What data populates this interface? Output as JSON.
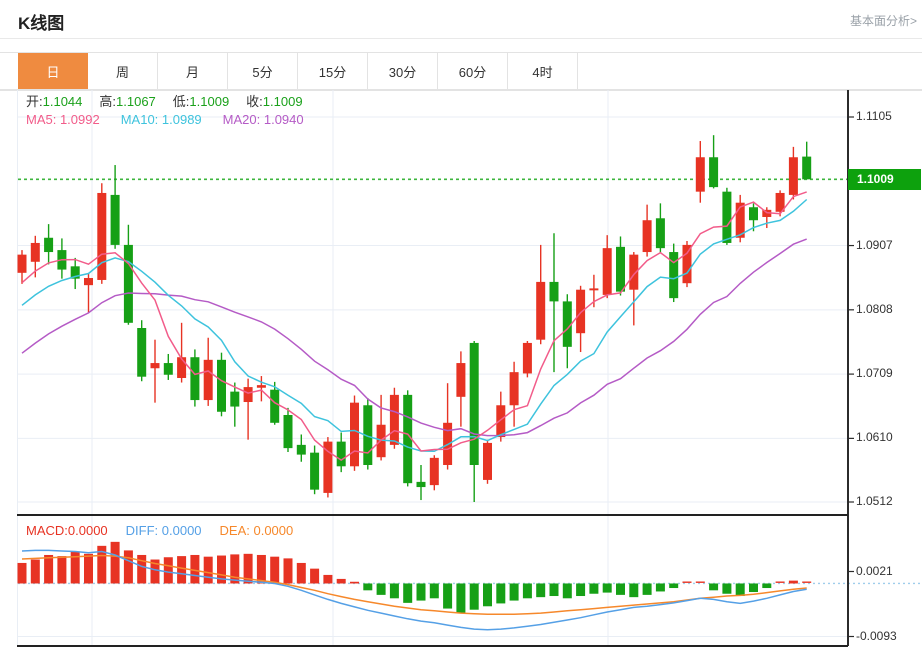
{
  "header": {
    "title": "K线图",
    "link": "基本面分析>"
  },
  "tabs": {
    "items": [
      "日",
      "周",
      "月",
      "5分",
      "15分",
      "30分",
      "60分",
      "4时"
    ],
    "active_index": 0
  },
  "overlay": {
    "ohlc": [
      {
        "label": "开:",
        "value": "1.1044"
      },
      {
        "label": "高:",
        "value": "1.1067"
      },
      {
        "label": "低:",
        "value": "1.1009"
      },
      {
        "label": "收:",
        "value": "1.1009"
      }
    ],
    "ma_legend": [
      {
        "text": "MA5: 1.0992",
        "color": "#f25c8a"
      },
      {
        "text": "MA10: 1.0989",
        "color": "#3ec3dd"
      },
      {
        "text": "MA20: 1.0940",
        "color": "#b55bc6"
      }
    ],
    "macd_legend": [
      {
        "text": "MACD:0.0000",
        "color": "#e73323"
      },
      {
        "text": "DIFF: 0.0000",
        "color": "#55a0e6"
      },
      {
        "text": "DEA: 0.0000",
        "color": "#f6882b"
      }
    ]
  },
  "axis": {
    "price_ticks": [
      {
        "label": "1.1105",
        "price": 1.1105
      },
      {
        "label": "1.0907",
        "price": 1.0907
      },
      {
        "label": "1.0808",
        "price": 1.0808
      },
      {
        "label": "1.0709",
        "price": 1.0709
      },
      {
        "label": "1.0610",
        "price": 1.061
      },
      {
        "label": "1.0512",
        "price": 1.0512
      }
    ],
    "macd_ticks": [
      {
        "label": "0.0021",
        "value": 0.0021
      },
      {
        "label": "-0.0093",
        "value": -0.0093
      }
    ],
    "current_price_label": "1.1009",
    "current_price": 1.1009
  },
  "colors": {
    "up": "#e73323",
    "down": "#16a016",
    "tab_active": "#ef8b40",
    "ohlc_value": "#1ba11b",
    "ma5": "#f25c8a",
    "ma10": "#3ec3dd",
    "ma20": "#b55bc6",
    "diff": "#55a0e6",
    "dea": "#f6882b",
    "price_line": "#3db53d",
    "price_flag_bg": "#0da10d",
    "grid": "#e9eef5",
    "zero_dash": "#9fcdec",
    "axis_line": "#2b2b2b"
  },
  "chart_data": {
    "type": "candlestick",
    "title": "K线图 (daily)",
    "price_axis_range": [
      1.0512,
      1.1105
    ],
    "macd_axis_range": [
      -0.0093,
      0.0021
    ],
    "legend_values": {
      "MA5": 1.0992,
      "MA10": 1.0989,
      "MA20": 1.094,
      "MACD": 0.0,
      "DIFF": 0.0,
      "DEA": 0.0
    },
    "ohlc_last": {
      "open": 1.1044,
      "high": 1.1067,
      "low": 1.1009,
      "close": 1.1009
    },
    "candles": [
      [
        1.0865,
        1.09,
        1.0848,
        1.0893
      ],
      [
        1.0882,
        1.0922,
        1.0858,
        1.0911
      ],
      [
        1.0919,
        1.094,
        1.0878,
        1.0897
      ],
      [
        1.09,
        1.0918,
        1.0856,
        1.087
      ],
      [
        1.0875,
        1.0888,
        1.084,
        1.0856
      ],
      [
        1.0846,
        1.0864,
        1.0803,
        1.0857
      ],
      [
        1.0854,
        1.1003,
        1.0848,
        1.0988
      ],
      [
        1.0985,
        1.1031,
        1.0902,
        1.0908
      ],
      [
        1.0908,
        1.0939,
        1.0785,
        1.0788
      ],
      [
        1.078,
        1.0792,
        1.0698,
        1.0705
      ],
      [
        1.0718,
        1.0762,
        1.0665,
        1.0726
      ],
      [
        1.0726,
        1.074,
        1.07,
        1.0708
      ],
      [
        1.0703,
        1.0788,
        1.0696,
        1.0735
      ],
      [
        1.0735,
        1.0747,
        1.0659,
        1.0669
      ],
      [
        1.0669,
        1.0765,
        1.066,
        1.0731
      ],
      [
        1.0731,
        1.0742,
        1.0644,
        1.0651
      ],
      [
        1.0682,
        1.0696,
        1.0628,
        1.0659
      ],
      [
        1.0666,
        1.0702,
        1.0608,
        1.0689
      ],
      [
        1.0688,
        1.0706,
        1.0667,
        1.0692
      ],
      [
        1.0685,
        1.0697,
        1.0631,
        1.0634
      ],
      [
        1.0646,
        1.0657,
        1.0589,
        1.0595
      ],
      [
        1.06,
        1.0616,
        1.0574,
        1.0585
      ],
      [
        1.0588,
        1.0599,
        1.0524,
        1.0531
      ],
      [
        1.0526,
        1.0612,
        1.0519,
        1.0605
      ],
      [
        1.0605,
        1.0619,
        1.0558,
        1.0567
      ],
      [
        1.0567,
        1.0676,
        1.056,
        1.0665
      ],
      [
        1.0661,
        1.0672,
        1.0562,
        1.0569
      ],
      [
        1.0581,
        1.0677,
        1.0576,
        1.0631
      ],
      [
        1.06,
        1.0688,
        1.0594,
        1.0677
      ],
      [
        1.0677,
        1.0684,
        1.0536,
        1.0541
      ],
      [
        1.0543,
        1.0569,
        1.0515,
        1.0535
      ],
      [
        1.0538,
        1.0584,
        1.053,
        1.058
      ],
      [
        1.0569,
        1.0695,
        1.0562,
        1.0634
      ],
      [
        1.0674,
        1.0744,
        1.0628,
        1.0726
      ],
      [
        1.0757,
        1.076,
        1.0512,
        1.0569
      ],
      [
        1.0546,
        1.0608,
        1.054,
        1.0603
      ],
      [
        1.0612,
        1.0682,
        1.0605,
        1.0661
      ],
      [
        1.0661,
        1.0728,
        1.0628,
        1.0712
      ],
      [
        1.071,
        1.076,
        1.0704,
        1.0757
      ],
      [
        1.0762,
        1.0908,
        1.0755,
        1.0851
      ],
      [
        1.0851,
        1.0926,
        1.0712,
        1.0821
      ],
      [
        1.0821,
        1.0832,
        1.0718,
        1.0751
      ],
      [
        1.0772,
        1.0845,
        1.0743,
        1.0839
      ],
      [
        1.0838,
        1.0862,
        1.0812,
        1.0841
      ],
      [
        1.0831,
        1.0923,
        1.0826,
        1.0903
      ],
      [
        1.0905,
        1.0921,
        1.083,
        1.0836
      ],
      [
        1.0839,
        1.0897,
        1.0784,
        1.0893
      ],
      [
        1.0897,
        1.097,
        1.089,
        1.0946
      ],
      [
        1.0949,
        1.0972,
        1.0896,
        1.0903
      ],
      [
        1.0897,
        1.091,
        1.082,
        1.0826
      ],
      [
        1.0849,
        1.0914,
        1.0843,
        1.0908
      ],
      [
        1.099,
        1.1068,
        1.0973,
        1.1043
      ],
      [
        1.1043,
        1.1077,
        1.0995,
        1.0997
      ],
      [
        1.099,
        1.0996,
        1.0908,
        1.0911
      ],
      [
        1.0919,
        1.0985,
        1.0912,
        1.0973
      ],
      [
        1.0966,
        1.0972,
        1.0929,
        1.0946
      ],
      [
        1.0951,
        1.0966,
        1.0934,
        1.0962
      ],
      [
        1.0959,
        1.0992,
        1.0952,
        1.0988
      ],
      [
        1.0985,
        1.1059,
        1.0978,
        1.1043
      ],
      [
        1.1044,
        1.1067,
        1.1009,
        1.1009
      ]
    ],
    "ma_periods": [
      5,
      10,
      20
    ],
    "ma_seed_closes": [
      1.06,
      1.0615,
      1.063,
      1.0645,
      1.066,
      1.0675,
      1.069,
      1.0705,
      1.072,
      1.0735,
      1.075,
      1.0765,
      1.078,
      1.0795,
      1.081,
      1.0822,
      1.0834,
      1.0845,
      1.0855
    ],
    "macd_histogram": [
      0.0036,
      0.0042,
      0.005,
      0.0048,
      0.0056,
      0.0052,
      0.0066,
      0.0073,
      0.0058,
      0.005,
      0.0042,
      0.0046,
      0.0048,
      0.005,
      0.0047,
      0.0049,
      0.0051,
      0.0052,
      0.005,
      0.0047,
      0.0044,
      0.0036,
      0.0026,
      0.0015,
      0.0008,
      0.0003,
      -0.0012,
      -0.002,
      -0.0026,
      -0.0034,
      -0.003,
      -0.0026,
      -0.0044,
      -0.0052,
      -0.0046,
      -0.004,
      -0.0035,
      -0.003,
      -0.0026,
      -0.0024,
      -0.0022,
      -0.0026,
      -0.0022,
      -0.0018,
      -0.0016,
      -0.002,
      -0.0024,
      -0.002,
      -0.0014,
      -0.0008,
      0.0001,
      0.0001,
      -0.0012,
      -0.0018,
      -0.0022,
      -0.0015,
      -0.0008,
      0.0001,
      0.0005,
      0.0001
    ],
    "diff_line": [
      0.0057,
      0.0058,
      0.0058,
      0.0057,
      0.0056,
      0.0054,
      0.0056,
      0.005,
      0.004,
      0.003,
      0.0024,
      0.002,
      0.0017,
      0.0014,
      0.0011,
      0.0008,
      0.0006,
      0.0004,
      0.0002,
      0.0,
      -0.0005,
      -0.0012,
      -0.002,
      -0.0028,
      -0.0035,
      -0.0041,
      -0.0047,
      -0.0052,
      -0.0057,
      -0.0062,
      -0.0066,
      -0.0069,
      -0.0073,
      -0.0077,
      -0.008,
      -0.0081,
      -0.008,
      -0.0078,
      -0.0075,
      -0.0072,
      -0.0068,
      -0.0064,
      -0.006,
      -0.0055,
      -0.005,
      -0.0046,
      -0.0042,
      -0.004,
      -0.0037,
      -0.0034,
      -0.003,
      -0.0026,
      -0.0028,
      -0.0032,
      -0.0035,
      -0.0031,
      -0.0026,
      -0.002,
      -0.0014,
      -0.001
    ],
    "dea_line": [
      0.0043,
      0.0044,
      0.0045,
      0.0046,
      0.0047,
      0.0048,
      0.0049,
      0.0048,
      0.0045,
      0.004,
      0.0035,
      0.0031,
      0.0027,
      0.0023,
      0.0019,
      0.0015,
      0.0011,
      0.0008,
      0.0005,
      0.0002,
      -0.0002,
      -0.0007,
      -0.0012,
      -0.0018,
      -0.0023,
      -0.0028,
      -0.0032,
      -0.0036,
      -0.004,
      -0.0043,
      -0.0046,
      -0.0048,
      -0.005,
      -0.0052,
      -0.0053,
      -0.0054,
      -0.0054,
      -0.0054,
      -0.0053,
      -0.0052,
      -0.005,
      -0.0048,
      -0.0046,
      -0.0044,
      -0.0042,
      -0.004,
      -0.0038,
      -0.0036,
      -0.0034,
      -0.0032,
      -0.0029,
      -0.0026,
      -0.0024,
      -0.0022,
      -0.0021,
      -0.0019,
      -0.0016,
      -0.0013,
      -0.001,
      -0.0008
    ]
  }
}
